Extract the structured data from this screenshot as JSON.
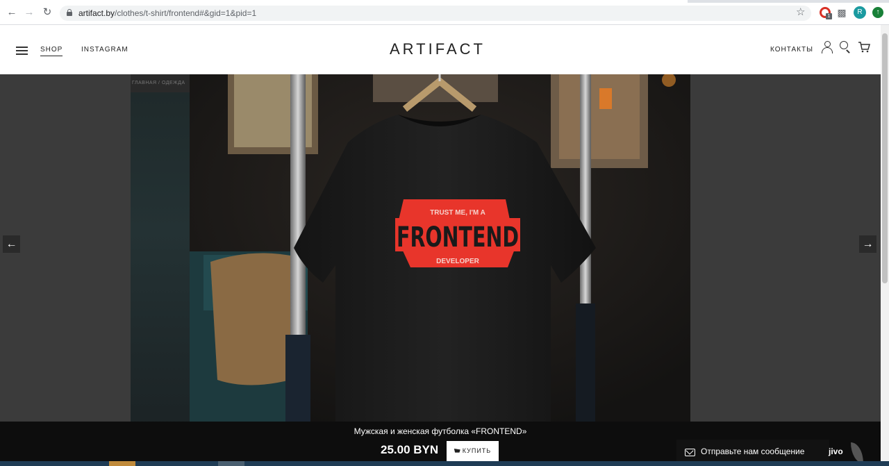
{
  "browser": {
    "url_host": "artifact.by",
    "url_path": "/clothes/t-shirt/frontend#&gid=1&pid=1",
    "ext_badge": "1",
    "avatar_letter": "R"
  },
  "header": {
    "nav_shop": "SHOP",
    "nav_instagram": "INSTAGRAM",
    "logo": "ARTIFACT",
    "nav_contacts": "КОНТАКТЫ"
  },
  "lightbox": {
    "breadcrumb": "ГЛАВНАЯ / ОДЕЖДА",
    "shirt_top": "TRUST ME, I'M A",
    "shirt_main": "FRONTEND",
    "shirt_bottom": "DEVELOPER",
    "product_title": "Мужская и женская футболка «FRONTEND»",
    "price": "25.00 BYN",
    "buy_label": "КУПИТЬ"
  },
  "chat": {
    "label": "Отправьте нам сообщение",
    "brand": "jivo"
  },
  "colors": {
    "shirt_print": "#e8352b",
    "overlay": "#3b3b3b",
    "caption_bar": "#0d0d0d"
  }
}
